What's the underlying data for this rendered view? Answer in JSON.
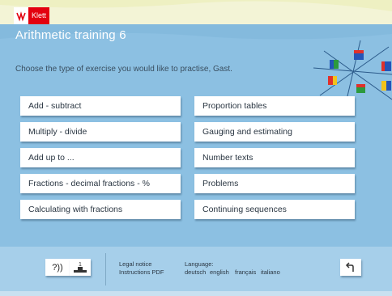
{
  "brand": {
    "logo_text": "Klett",
    "logo_color": "#e3000f"
  },
  "page": {
    "title": "Arithmetic training 6",
    "subtitle": "Choose the type of exercise you would like to practise, Gast."
  },
  "exercises": {
    "left": [
      "Add - subtract",
      "Multiply - divide",
      "Add up to ...",
      "Fractions - decimal fractions - %",
      "Calculating with fractions"
    ],
    "right": [
      "Proportion tables",
      "Gauging and estimating",
      "Number texts",
      "Problems",
      "Continuing sequences"
    ]
  },
  "footer": {
    "help_label": "?))",
    "level_label": "1",
    "legal_notice": "Legal notice",
    "instructions": "Instructions PDF",
    "language_label": "Language:",
    "languages": [
      "deutsch",
      "english",
      "français",
      "italiano"
    ],
    "back_icon": "back-arrow-icon"
  },
  "colors": {
    "top_band": "#eef0c2",
    "main_bg": "#8cc0e2",
    "footer_bg": "#a6cfea",
    "title_text": "#ffffff"
  }
}
